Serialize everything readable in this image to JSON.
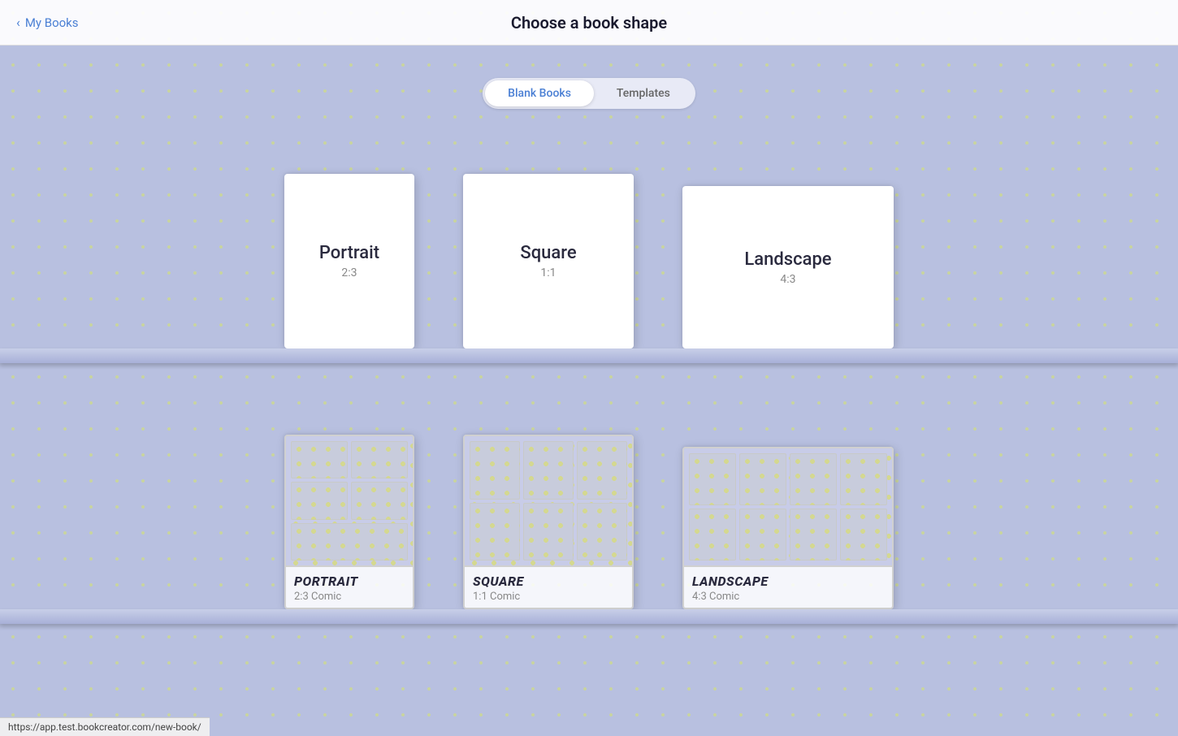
{
  "header": {
    "title": "Choose a book shape",
    "back_label": "My Books"
  },
  "tabs": [
    {
      "id": "blank",
      "label": "Blank Books",
      "active": true
    },
    {
      "id": "templates",
      "label": "Templates",
      "active": false
    }
  ],
  "blank_books": [
    {
      "id": "portrait",
      "title": "Portrait",
      "ratio": "2:3"
    },
    {
      "id": "square",
      "title": "Square",
      "ratio": "1:1"
    },
    {
      "id": "landscape",
      "title": "Landscape",
      "ratio": "4:3"
    }
  ],
  "comic_books": [
    {
      "id": "portrait-comic",
      "title": "PORTRAIT",
      "ratio": "2:3 Comic"
    },
    {
      "id": "square-comic",
      "title": "SQUARE",
      "ratio": "1:1 Comic"
    },
    {
      "id": "landscape-comic",
      "title": "LANDSCAPE",
      "ratio": "4:3 Comic"
    }
  ],
  "status_bar": {
    "url": "https://app.test.bookcreator.com/new-book/"
  },
  "icons": {
    "back_arrow": "‹"
  }
}
